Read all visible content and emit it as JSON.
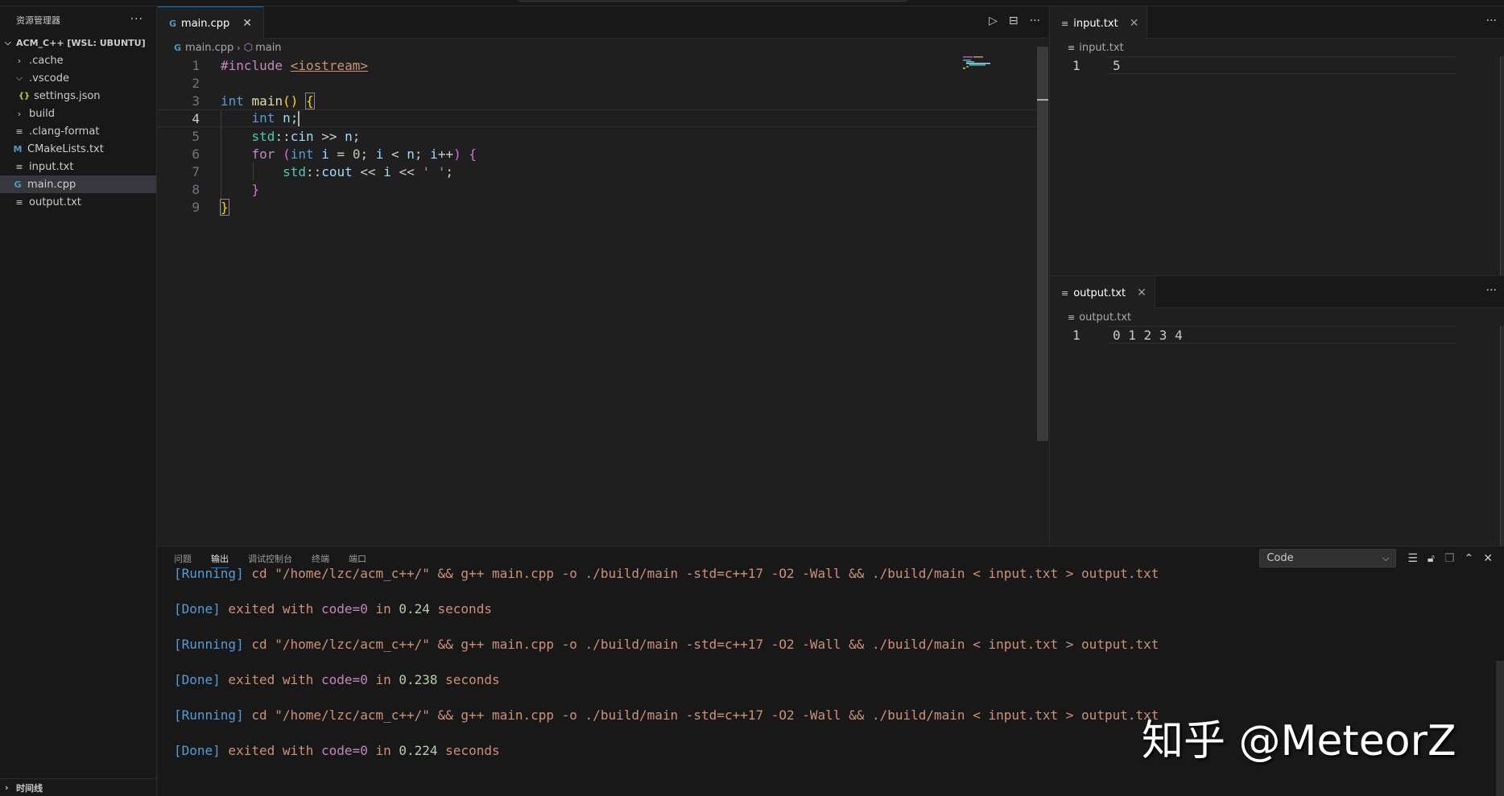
{
  "sidebar": {
    "title": "资源管理器",
    "more_icon": "ellipsis-icon",
    "root": "ACM_C++ [WSL: UBUNTU]",
    "items": [
      {
        "label": ".cache",
        "type": "folder",
        "expanded": false,
        "depth": 1
      },
      {
        "label": ".vscode",
        "type": "folder",
        "expanded": true,
        "depth": 1
      },
      {
        "label": "settings.json",
        "type": "json",
        "depth": 2
      },
      {
        "label": "build",
        "type": "folder",
        "expanded": false,
        "depth": 1
      },
      {
        "label": ".clang-format",
        "type": "text",
        "depth": 1
      },
      {
        "label": "CMakeLists.txt",
        "type": "cmake",
        "depth": 1
      },
      {
        "label": "input.txt",
        "type": "text",
        "depth": 1
      },
      {
        "label": "main.cpp",
        "type": "cpp",
        "depth": 1,
        "selected": true
      },
      {
        "label": "output.txt",
        "type": "text",
        "depth": 1
      }
    ],
    "timeline": "时间线"
  },
  "editor": {
    "tab": {
      "label": "main.cpp",
      "icon": "cpp-file-icon"
    },
    "actions": [
      "run-icon",
      "split-editor-icon",
      "ellipsis-icon"
    ],
    "breadcrumb": [
      "main.cpp",
      "main"
    ],
    "line_numbers": [
      "1",
      "2",
      "3",
      "4",
      "5",
      "6",
      "7",
      "8",
      "9"
    ],
    "current_line": 4,
    "code": {
      "l1_pp": "#include",
      "l1_hdr": "<iostream>",
      "l3_type": "int",
      "l3_fn": "main",
      "l3_paren": "()",
      "l3_brace": "{",
      "l4_type": "int",
      "l4_var": "n",
      "l4_semi": ";",
      "l5_ns": "std",
      "l5_sep": "::",
      "l5_obj": "cin",
      "l5_op": " >> ",
      "l5_var": "n",
      "l5_semi": ";",
      "l6_for": "for",
      "l6_p1": "(",
      "l6_int": "int",
      "l6_i": "i",
      "l6_eq": " = ",
      "l6_zero": "0",
      "l6_semi1": "; ",
      "l6_i2": "i",
      "l6_lt": " < ",
      "l6_n": "n",
      "l6_semi2": "; ",
      "l6_i3": "i",
      "l6_inc": "++",
      "l6_p2": ")",
      "l6_brace": "{",
      "l7_ns": "std",
      "l7_sep": "::",
      "l7_obj": "cout",
      "l7_op1": " << ",
      "l7_i": "i",
      "l7_op2": " << ",
      "l7_chr": "' '",
      "l7_semi": ";",
      "l8_brace": "}",
      "l9_brace": "}"
    }
  },
  "input_pane": {
    "tab": "input.txt",
    "breadcrumb": "input.txt",
    "lines": [
      {
        "num": "1",
        "text": "5"
      }
    ]
  },
  "output_pane": {
    "tab": "output.txt",
    "breadcrumb": "output.txt",
    "lines": [
      {
        "num": "1",
        "text": "0 1 2 3 4"
      }
    ]
  },
  "panel": {
    "tabs": [
      "问题",
      "输出",
      "调试控制台",
      "终端",
      "端口"
    ],
    "active_tab": "输出",
    "channel_select": "Code",
    "tools": [
      "clear-output-icon",
      "lock-scroll-icon",
      "copy-icon",
      "maximize-panel-icon",
      "close-panel-icon"
    ],
    "log": [
      {
        "tag": "[Running]",
        "text": " cd \"/home/lzc/acm_c++/\" && g++ main.cpp -o ./build/main -std=c++17 -O2 -Wall && ./build/main < input.txt > output.txt"
      },
      {
        "tag": "[Done]",
        "pre": " exited with ",
        "code": "code=0",
        "mid": " in ",
        "time": "0.24",
        "post": " seconds"
      },
      {
        "tag": "[Running]",
        "text": " cd \"/home/lzc/acm_c++/\" && g++ main.cpp -o ./build/main -std=c++17 -O2 -Wall && ./build/main < input.txt > output.txt"
      },
      {
        "tag": "[Done]",
        "pre": " exited with ",
        "code": "code=0",
        "mid": " in ",
        "time": "0.238",
        "post": " seconds"
      },
      {
        "tag": "[Running]",
        "text": " cd \"/home/lzc/acm_c++/\" && g++ main.cpp -o ./build/main -std=c++17 -O2 -Wall && ./build/main < input.txt > output.txt"
      },
      {
        "tag": "[Done]",
        "pre": " exited with ",
        "code": "code=0",
        "mid": " in ",
        "time": "0.224",
        "post": " seconds"
      }
    ]
  },
  "watermark": "知乎 @MeteorZ"
}
